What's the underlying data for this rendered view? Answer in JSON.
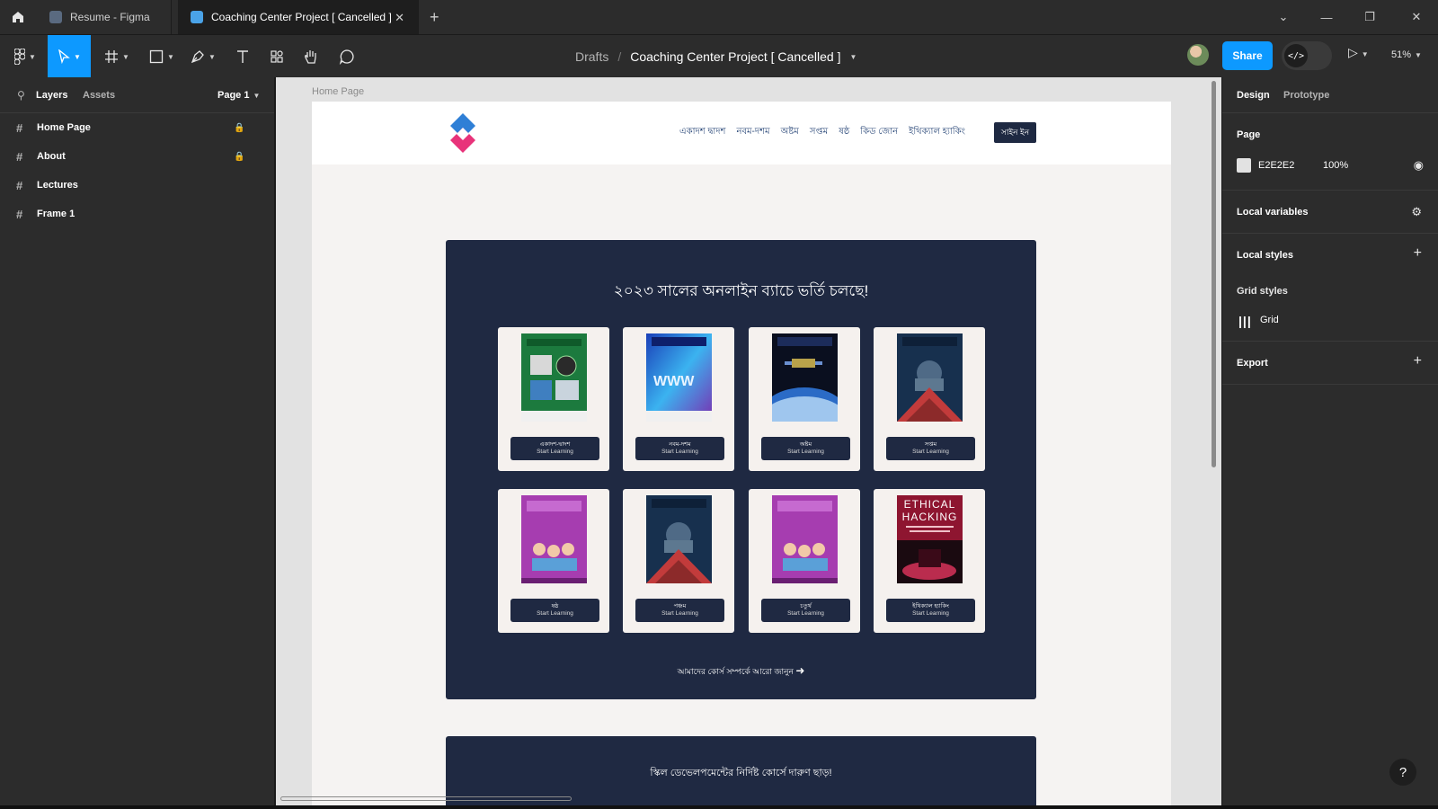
{
  "tabs": [
    {
      "label": "Resume - Figma"
    },
    {
      "label": "Coaching Center Project [ Cancelled ]"
    }
  ],
  "toolbar": {
    "breadcrumb_root": "Drafts",
    "breadcrumb_sep": "/",
    "project_title": "Coaching Center Project [ Cancelled ]",
    "share_label": "Share",
    "dev_mode_icon": "</>",
    "zoom": "51%"
  },
  "left_panel": {
    "tab_layers": "Layers",
    "tab_assets": "Assets",
    "page_selector": "Page 1",
    "layers": [
      {
        "name": "Home Page",
        "locked": true
      },
      {
        "name": "About",
        "locked": true
      },
      {
        "name": "Lectures",
        "locked": false
      },
      {
        "name": "Frame 1",
        "locked": false
      }
    ]
  },
  "canvas": {
    "frame_label": "Home Page",
    "nav_links": [
      "একাদশ দ্বাদশ",
      "নবম-দশম",
      "অষ্টম",
      "সপ্তম",
      "ষষ্ঠ",
      "কিড জোন",
      "ইথিক্যাল হ্যাকিং"
    ],
    "signin_label": "সাইন ইন",
    "panel_title": "২০২৩ সালের অনলাইন ব্যাচে ভর্তি চলছে!",
    "course_button_sub": "Start Learning",
    "courses": [
      {
        "label": "একাদশ-দ্বাদশ",
        "cover": "green"
      },
      {
        "label": "নবম-দশম",
        "cover": "www"
      },
      {
        "label": "অষ্টম",
        "cover": "space"
      },
      {
        "label": "সপ্তম",
        "cover": "robot"
      },
      {
        "label": "ষষ্ঠ",
        "cover": "purple"
      },
      {
        "label": "পঞ্চম",
        "cover": "robot"
      },
      {
        "label": "চতুর্থ",
        "cover": "purple"
      },
      {
        "label": "ইথিক্যাল হ্যাকিং",
        "cover": "hacking"
      }
    ],
    "more_link": "আমাদের কোর্স সম্পর্কে আরো জানুন",
    "second_title": "স্কিল ডেভেলপমেন্টের নির্দিষ্ট কোর্সে দারুণ ছাড়!",
    "hacking_cover_title_1": "ETHICAL",
    "hacking_cover_title_2": "HACKING"
  },
  "right_panel": {
    "tab_design": "Design",
    "tab_prototype": "Prototype",
    "page_heading": "Page",
    "page_color": "E2E2E2",
    "page_opacity": "100%",
    "local_variables": "Local variables",
    "local_styles": "Local styles",
    "grid_styles": "Grid styles",
    "grid_item": "Grid",
    "export": "Export"
  },
  "colors": {
    "accent": "#0d99ff",
    "panel_bg": "#2c2c2c",
    "canvas_bg": "#e2e2e2",
    "site_dark": "#1f2942"
  }
}
